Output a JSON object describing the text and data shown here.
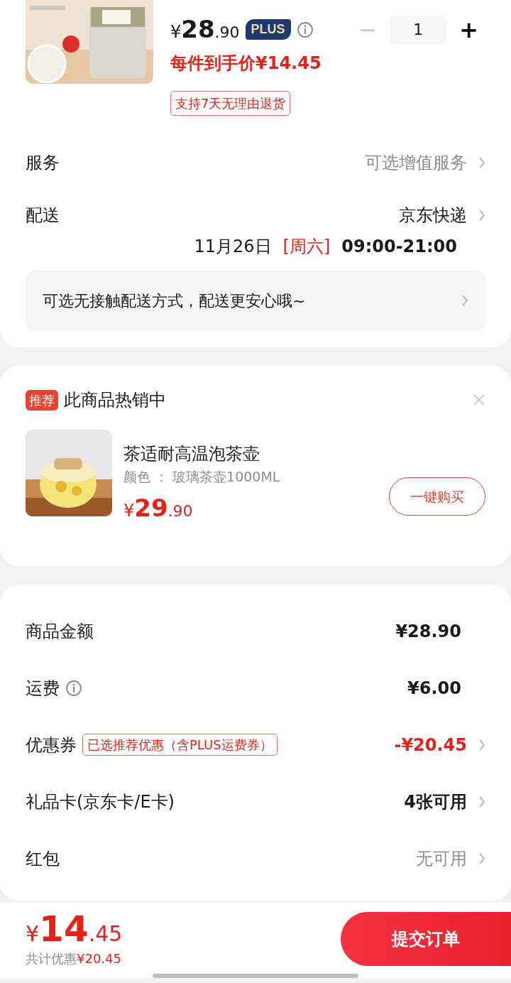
{
  "product": {
    "kind": "picture",
    "price": {
      "symbol": "¥",
      "integer": "28",
      "decimal": ".90"
    },
    "member_badge": "PLUS",
    "quantity": "1",
    "minus": "−",
    "plus": "+",
    "minus_disabled": true,
    "unit_price": "每件到手价¥14.45",
    "return_tag": "支持7天无理由退货"
  },
  "service": {
    "label": "服务",
    "value": "可选增值服务"
  },
  "delivery": {
    "label": "配送",
    "carrier": "京东快递",
    "date": "11月26日",
    "weekday": "[周六]",
    "time": "09:00-21:00",
    "notice": "可选无接触配送方式，配送更安心哦~"
  },
  "recommend": {
    "badge": "推荐",
    "title": "此商品热销中",
    "item": {
      "kind": "picture",
      "name": "茶适耐高温泡茶壶",
      "spec": "颜色 ： 玻璃茶壶1000ML",
      "price": {
        "symbol": "¥",
        "integer": "29",
        "decimal": ".90"
      },
      "button": "一键购买"
    }
  },
  "summary": [
    {
      "label": "商品金额",
      "info": false,
      "value": "¥28.90",
      "discount": false,
      "muted": false,
      "chevron": false
    },
    {
      "label": "运费",
      "info": true,
      "value": "¥6.00",
      "discount": false,
      "muted": false,
      "chevron": false
    },
    {
      "label": "优惠券",
      "info": false,
      "tag": "已选推荐优惠（含PLUS运费券）",
      "value": "-¥20.45",
      "discount": true,
      "muted": false,
      "chevron": true
    },
    {
      "label": "礼品卡(京东卡/E卡)",
      "info": false,
      "value": "4张可用",
      "discount": false,
      "muted": false,
      "chevron": true
    },
    {
      "label": "红包",
      "info": false,
      "value": "无可用",
      "discount": false,
      "muted": true,
      "chevron": true
    }
  ],
  "footer": {
    "total": {
      "symbol": "¥",
      "integer": "14",
      "decimal": ".45"
    },
    "savings_label": "共计优惠",
    "savings_amount": "¥20.45",
    "submit": "提交订单"
  }
}
